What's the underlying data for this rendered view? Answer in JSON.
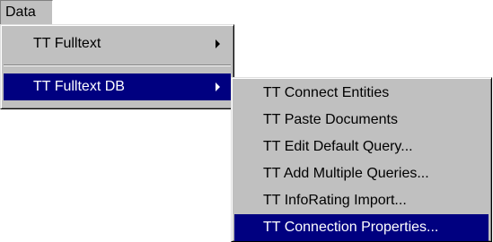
{
  "menubar": {
    "data_label": "Data"
  },
  "data_menu": {
    "items": [
      {
        "label": "TT Fulltext",
        "has_submenu": true
      },
      {
        "label": "TT Fulltext DB",
        "has_submenu": true,
        "highlighted": true
      }
    ]
  },
  "fulltext_db_submenu": {
    "items": [
      {
        "label": "TT Connect Entities"
      },
      {
        "label": "TT Paste Documents"
      },
      {
        "label": "TT Edit Default Query..."
      },
      {
        "label": "TT Add Multiple Queries..."
      },
      {
        "label": "TT InfoRating Import..."
      },
      {
        "label": "TT Connection Properties...",
        "highlighted": true
      }
    ]
  },
  "icons": {
    "submenu_arrow": "chevron-right-icon"
  },
  "colors": {
    "menu_face": "#c0c0c0",
    "highlight": "#000080",
    "highlight_text": "#ffffff"
  }
}
